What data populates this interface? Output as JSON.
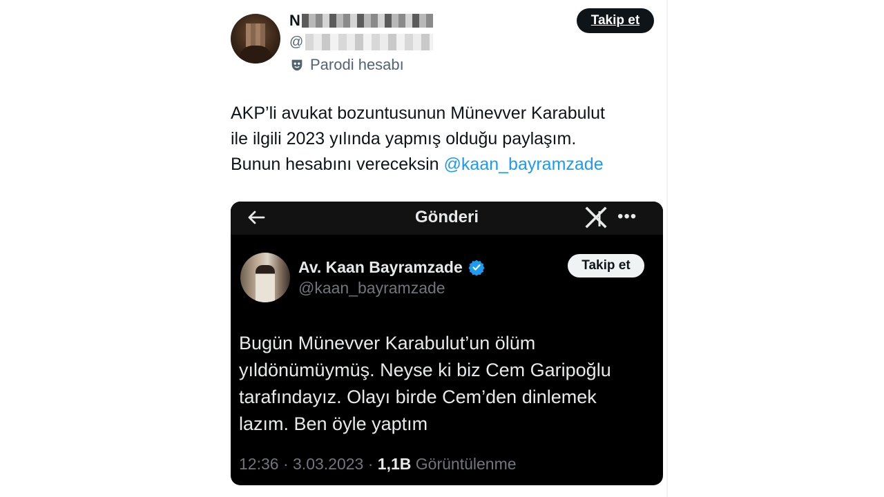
{
  "outer_tweet": {
    "name_initial": "N",
    "handle_prefix": "@",
    "label": "Parodi hesabı",
    "follow_label": "Takip et",
    "text_lines": [
      "AKP’li avukat bozuntusunun Münevver Karabulut",
      "ile ilgili 2023 yılında yapmış olduğu paylaşım.",
      "Bunun hesabını vereceksin "
    ],
    "mention": "@kaan_bayramzade"
  },
  "embedded_post": {
    "title": "Gönderi",
    "author_name": "Av. Kaan Bayramzade",
    "author_handle": "@kaan_bayramzade",
    "follow_label": "Takip et",
    "text_lines": [
      "Bugün Münevver Karabulut’un ölüm",
      "yıldönümüymüş. Neyse ki biz Cem Garipoğlu",
      "tarafındayız. Olayı birde Cem’den dinlemek",
      "lazım. Ben öyle yaptım"
    ],
    "time": "12:36",
    "date": "3.03.2023",
    "separator": " · ",
    "views_count": "1,1B",
    "views_label": "Görüntülenme"
  },
  "icons": {
    "back": "back-arrow-icon",
    "logo": "x-logo-icon",
    "more": "more-icon",
    "verified": "verified-icon",
    "parody": "parody-mask-icon"
  },
  "colors": {
    "link": "#1d9bf0",
    "dark_bg": "#000000",
    "muted": "#71767b",
    "verified": "#1d9bf0"
  }
}
